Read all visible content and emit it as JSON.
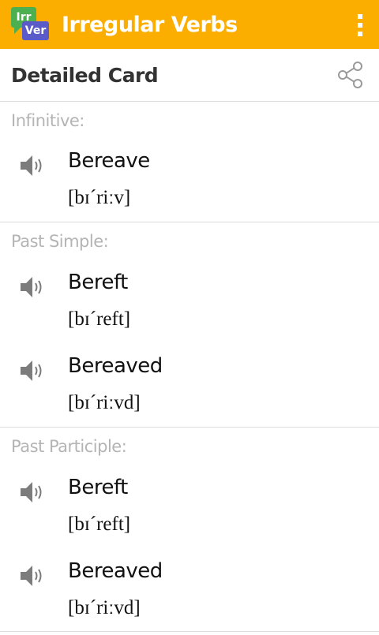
{
  "app": {
    "title": "Irregular Verbs",
    "logo_top": "Irr",
    "logo_bottom": "Ver"
  },
  "card": {
    "title": "Detailed Card"
  },
  "sections": [
    {
      "label": "Infinitive:",
      "entries": [
        {
          "word": "Bereave",
          "ipa": "[bɪˊriːv]"
        }
      ]
    },
    {
      "label": "Past Simple:",
      "entries": [
        {
          "word": "Bereft",
          "ipa": "[bɪˊreft]"
        },
        {
          "word": "Bereaved",
          "ipa": "[bɪˊriːvd]"
        }
      ]
    },
    {
      "label": "Past Participle:",
      "entries": [
        {
          "word": "Bereft",
          "ipa": "[bɪˊreft]"
        },
        {
          "word": "Bereaved",
          "ipa": "[bɪˊriːvd]"
        }
      ]
    }
  ],
  "colors": {
    "appbar": "#fbae00",
    "label": "#b4b4b4",
    "divider": "#dcdcdc"
  },
  "icons": {
    "menu": "overflow-menu-icon",
    "share": "share-icon",
    "speaker": "speaker-icon"
  }
}
